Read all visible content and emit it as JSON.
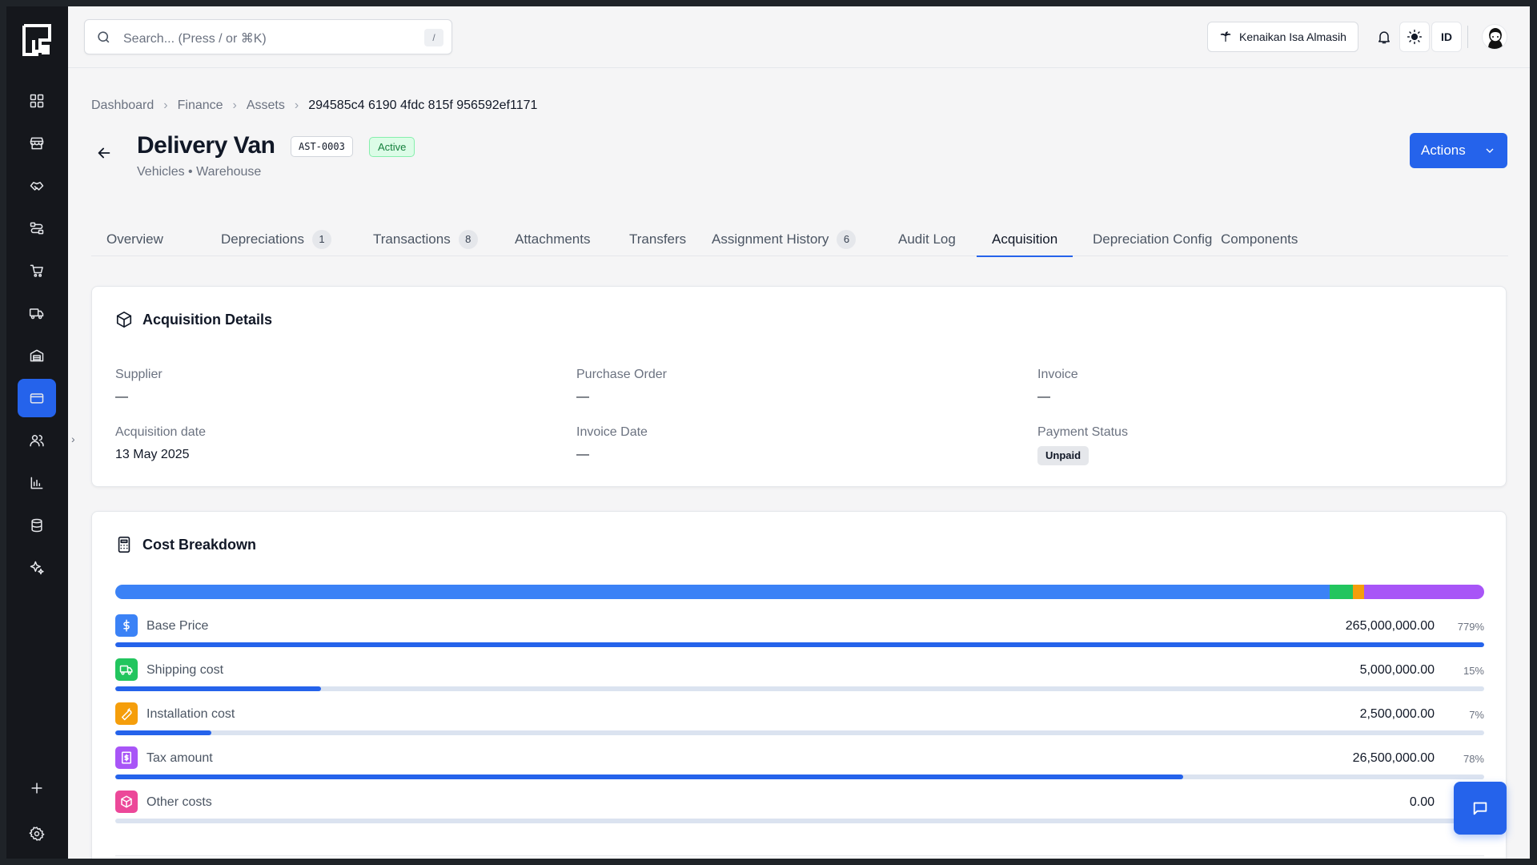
{
  "sidebar": {
    "nav": [
      {
        "icon": "dashboard-grid-icon"
      },
      {
        "icon": "store-icon"
      },
      {
        "icon": "handshake-icon"
      },
      {
        "icon": "workflow-icon"
      },
      {
        "icon": "cart-icon"
      },
      {
        "icon": "truck-icon"
      },
      {
        "icon": "warehouse-icon"
      },
      {
        "icon": "credit-card-icon",
        "active": true
      },
      {
        "icon": "users-icon"
      },
      {
        "icon": "bar-chart-icon"
      },
      {
        "icon": "database-icon"
      },
      {
        "icon": "sparkle-icon"
      }
    ],
    "add_icon": "plus-icon",
    "settings_icon": "gear-icon"
  },
  "topbar": {
    "search_placeholder": "Search... (Press / or ⌘K)",
    "search_shortcut": "/",
    "tenant_name": "Kenaikan Isa Almasih",
    "language": "ID"
  },
  "collapse_toggle": "›",
  "breadcrumb": [
    "Dashboard",
    "Finance",
    "Assets",
    "294585c4 6190 4fdc 815f 956592ef1171"
  ],
  "asset": {
    "name": "Delivery Van",
    "code": "AST-0003",
    "status": "Active",
    "subtitle": "Vehicles • Warehouse"
  },
  "actions_label": "Actions",
  "tabs": [
    {
      "label": "Overview"
    },
    {
      "label": "Depreciations",
      "count": "1"
    },
    {
      "label": "Transactions",
      "count": "8"
    },
    {
      "label": "Attachments"
    },
    {
      "label": "Transfers"
    },
    {
      "label": "Assignment History",
      "count": "6"
    },
    {
      "label": "Audit Log"
    },
    {
      "label": "Acquisition",
      "active": true
    },
    {
      "label": "Depreciation Config"
    },
    {
      "label": "Components"
    }
  ],
  "acquisition": {
    "title": "Acquisition Details",
    "fields": [
      {
        "label": "Supplier",
        "value": "—"
      },
      {
        "label": "Purchase Order",
        "value": "—"
      },
      {
        "label": "Invoice",
        "value": "—"
      },
      {
        "label": "Acquisition date",
        "value": "13 May 2025"
      },
      {
        "label": "Invoice Date",
        "value": "—"
      },
      {
        "label": "Payment Status",
        "value": "Unpaid"
      }
    ]
  },
  "cost_breakdown": {
    "title": "Cost Breakdown",
    "stack": [
      {
        "color": "#3b82f6",
        "share": 0.887
      },
      {
        "color": "#22c55e",
        "share": 0.017
      },
      {
        "color": "#f59e0b",
        "share": 0.008
      },
      {
        "color": "#a855f7",
        "share": 0.088
      }
    ],
    "items": [
      {
        "label": "Base Price",
        "amount": "265,000,000.00",
        "pct": "779%",
        "fill": 1.0,
        "color": "#3b82f6",
        "icon": "dollar-icon"
      },
      {
        "label": "Shipping cost",
        "amount": "5,000,000.00",
        "pct": "15%",
        "fill": 0.15,
        "color": "#22c55e",
        "icon": "truck-icon"
      },
      {
        "label": "Installation cost",
        "amount": "2,500,000.00",
        "pct": "7%",
        "fill": 0.07,
        "color": "#f59e0b",
        "icon": "wrench-icon"
      },
      {
        "label": "Tax amount",
        "amount": "26,500,000.00",
        "pct": "78%",
        "fill": 0.78,
        "color": "#a855f7",
        "icon": "receipt-icon"
      },
      {
        "label": "Other costs",
        "amount": "0.00",
        "pct": "",
        "fill": 0,
        "color": "#ec4899",
        "icon": "package-icon"
      }
    ]
  }
}
